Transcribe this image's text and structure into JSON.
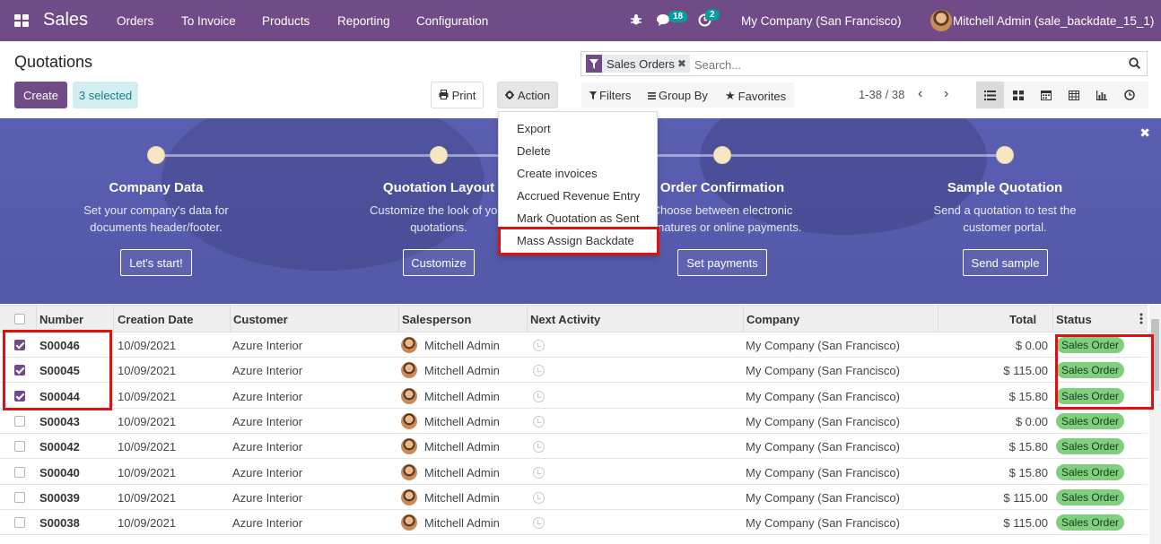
{
  "navbar": {
    "app_name": "Sales",
    "menu": [
      "Orders",
      "To Invoice",
      "Products",
      "Reporting",
      "Configuration"
    ],
    "messages_count": "18",
    "activities_count": "2",
    "company": "My Company (San Francisco)",
    "user": "Mitchell Admin (sale_backdate_15_1)"
  },
  "control": {
    "title": "Quotations",
    "create_label": "Create",
    "selected_label": "3 selected",
    "print_label": "Print",
    "action_label": "Action",
    "facet_label": "Sales Orders",
    "search_placeholder": "Search...",
    "filters_label": "Filters",
    "groupby_label": "Group By",
    "favorites_label": "Favorites",
    "pager_label": "1-38 / 38"
  },
  "action_menu": [
    "Export",
    "Delete",
    "Create invoices",
    "Accrued Revenue Entry",
    "Mark Quotation as Sent",
    "Mass Assign Backdate"
  ],
  "banner": {
    "steps": [
      {
        "title": "Company Data",
        "desc1": "Set your company's data for",
        "desc2": "documents header/footer.",
        "button": "Let's start!"
      },
      {
        "title": "Quotation Layout",
        "desc1": "Customize the look of your",
        "desc2": "quotations.",
        "button": "Customize"
      },
      {
        "title": "Order Confirmation",
        "desc1": "Choose between electronic",
        "desc2": "signatures or online payments.",
        "button": "Set payments"
      },
      {
        "title": "Sample Quotation",
        "desc1": "Send a quotation to test the",
        "desc2": "customer portal.",
        "button": "Send sample"
      }
    ]
  },
  "table": {
    "headers": [
      "Number",
      "Creation Date",
      "Customer",
      "Salesperson",
      "Next Activity",
      "Company",
      "Total",
      "Status"
    ],
    "rows": [
      {
        "number": "S00046",
        "date": "10/09/2021",
        "customer": "Azure Interior",
        "salesperson": "Mitchell Admin",
        "company": "My Company (San Francisco)",
        "total": "$ 0.00",
        "status": "Sales Order",
        "checked": true
      },
      {
        "number": "S00045",
        "date": "10/09/2021",
        "customer": "Azure Interior",
        "salesperson": "Mitchell Admin",
        "company": "My Company (San Francisco)",
        "total": "$ 115.00",
        "status": "Sales Order",
        "checked": true
      },
      {
        "number": "S00044",
        "date": "10/09/2021",
        "customer": "Azure Interior",
        "salesperson": "Mitchell Admin",
        "company": "My Company (San Francisco)",
        "total": "$ 15.80",
        "status": "Sales Order",
        "checked": true
      },
      {
        "number": "S00043",
        "date": "10/09/2021",
        "customer": "Azure Interior",
        "salesperson": "Mitchell Admin",
        "company": "My Company (San Francisco)",
        "total": "$ 0.00",
        "status": "Sales Order",
        "checked": false
      },
      {
        "number": "S00042",
        "date": "10/09/2021",
        "customer": "Azure Interior",
        "salesperson": "Mitchell Admin",
        "company": "My Company (San Francisco)",
        "total": "$ 15.80",
        "status": "Sales Order",
        "checked": false
      },
      {
        "number": "S00040",
        "date": "10/09/2021",
        "customer": "Azure Interior",
        "salesperson": "Mitchell Admin",
        "company": "My Company (San Francisco)",
        "total": "$ 15.80",
        "status": "Sales Order",
        "checked": false
      },
      {
        "number": "S00039",
        "date": "10/09/2021",
        "customer": "Azure Interior",
        "salesperson": "Mitchell Admin",
        "company": "My Company (San Francisco)",
        "total": "$ 115.00",
        "status": "Sales Order",
        "checked": false
      },
      {
        "number": "S00038",
        "date": "10/09/2021",
        "customer": "Azure Interior",
        "salesperson": "Mitchell Admin",
        "company": "My Company (San Francisco)",
        "total": "$ 115.00",
        "status": "Sales Order",
        "checked": false
      }
    ]
  },
  "colors": {
    "brand": "#714b87",
    "banner": "#5a5fb2",
    "status_badge": "#7fcf7f",
    "highlight": "#e01010"
  },
  "icons": [
    "apps-icon",
    "bug-icon",
    "chat-icon",
    "clock-icon",
    "filter-icon",
    "close-icon",
    "search-icon",
    "print-icon",
    "gear-icon",
    "star-icon",
    "list-view-icon",
    "kanban-view-icon",
    "calendar-view-icon",
    "pivot-view-icon",
    "graph-view-icon",
    "activity-view-icon",
    "options-icon"
  ]
}
